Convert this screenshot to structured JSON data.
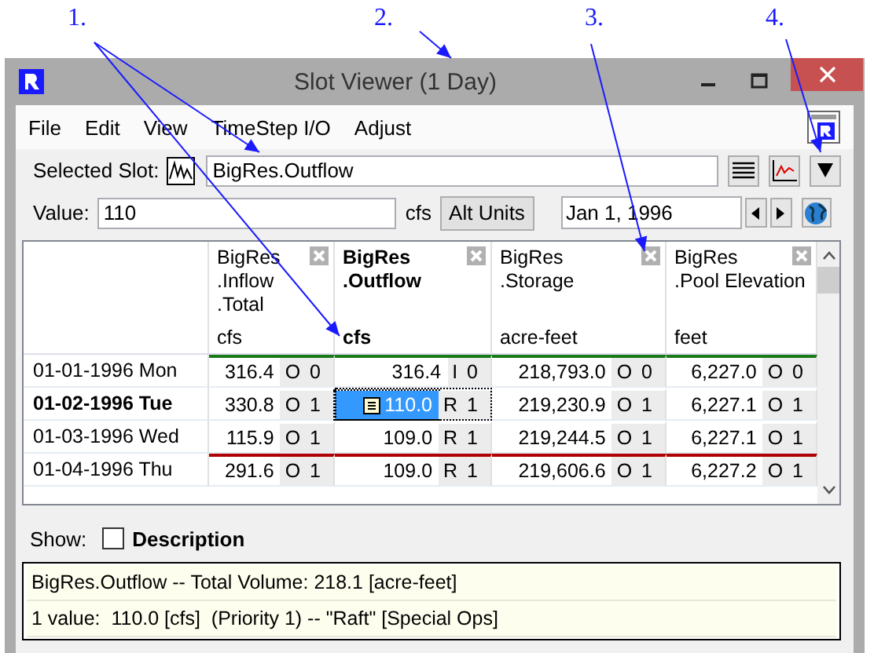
{
  "annotations": [
    {
      "label": "1."
    },
    {
      "label": "2."
    },
    {
      "label": "3."
    },
    {
      "label": "4."
    }
  ],
  "window": {
    "title": "Slot Viewer (1 Day)"
  },
  "menu": [
    "File",
    "Edit",
    "View",
    "TimeStep I/O",
    "Adjust"
  ],
  "selected_slot": {
    "label": "Selected Slot:",
    "value": "BigRes.Outflow"
  },
  "value_row": {
    "label": "Value:",
    "value": "110",
    "units": "cfs",
    "alt_units_button": "Alt Units",
    "date": "Jan 1, 1996"
  },
  "table": {
    "columns": [
      {
        "name_lines": [
          "BigRes",
          ".Inflow",
          ".Total"
        ],
        "units": "cfs",
        "selected": false
      },
      {
        "name_lines": [
          "BigRes",
          ".Outflow"
        ],
        "units": "cfs",
        "selected": true
      },
      {
        "name_lines": [
          "BigRes",
          ".Storage"
        ],
        "units": "acre-feet",
        "selected": false
      },
      {
        "name_lines": [
          "BigRes",
          ".Pool Elevation"
        ],
        "units": "feet",
        "selected": false
      }
    ],
    "rows": [
      {
        "date": "01-01-1996 Mon",
        "selected": false,
        "start_line_above": true,
        "end_line_above": false,
        "cells": [
          {
            "value": "316.4",
            "flag": "O",
            "priority": "0",
            "selected": false,
            "note": false
          },
          {
            "value": "316.4",
            "flag": "I",
            "priority": "0",
            "selected": false,
            "note": false
          },
          {
            "value": "218,793.0",
            "flag": "O",
            "priority": "0",
            "selected": false,
            "note": false
          },
          {
            "value": "6,227.0",
            "flag": "O",
            "priority": "0",
            "selected": false,
            "note": false
          }
        ]
      },
      {
        "date": "01-02-1996 Tue",
        "selected": true,
        "start_line_above": false,
        "end_line_above": false,
        "cells": [
          {
            "value": "330.8",
            "flag": "O",
            "priority": "1",
            "selected": false,
            "note": false
          },
          {
            "value": "110.0",
            "flag": "R",
            "priority": "1",
            "selected": true,
            "note": true
          },
          {
            "value": "219,230.9",
            "flag": "O",
            "priority": "1",
            "selected": false,
            "note": false
          },
          {
            "value": "6,227.1",
            "flag": "O",
            "priority": "1",
            "selected": false,
            "note": false
          }
        ]
      },
      {
        "date": "01-03-1996 Wed",
        "selected": false,
        "start_line_above": false,
        "end_line_above": false,
        "cells": [
          {
            "value": "115.9",
            "flag": "O",
            "priority": "1",
            "selected": false,
            "note": false
          },
          {
            "value": "109.0",
            "flag": "R",
            "priority": "1",
            "selected": false,
            "note": false
          },
          {
            "value": "219,244.5",
            "flag": "O",
            "priority": "1",
            "selected": false,
            "note": false
          },
          {
            "value": "6,227.1",
            "flag": "O",
            "priority": "1",
            "selected": false,
            "note": false
          }
        ]
      },
      {
        "date": "01-04-1996 Thu",
        "selected": false,
        "start_line_above": false,
        "end_line_above": true,
        "cells": [
          {
            "value": "291.6",
            "flag": "O",
            "priority": "1",
            "selected": false,
            "note": false
          },
          {
            "value": "109.0",
            "flag": "R",
            "priority": "1",
            "selected": false,
            "note": false
          },
          {
            "value": "219,606.6",
            "flag": "O",
            "priority": "1",
            "selected": false,
            "note": false
          },
          {
            "value": "6,227.2",
            "flag": "O",
            "priority": "1",
            "selected": false,
            "note": false
          }
        ]
      }
    ]
  },
  "show": {
    "label": "Show:",
    "checkbox_label": "Description",
    "checked": false
  },
  "status_lines": [
    "BigRes.Outflow -- Total Volume: 218.1 [acre-feet]",
    "1 value:  110.0 [cfs]  (Priority 1) -- \"Raft\" [Special Ops]"
  ]
}
